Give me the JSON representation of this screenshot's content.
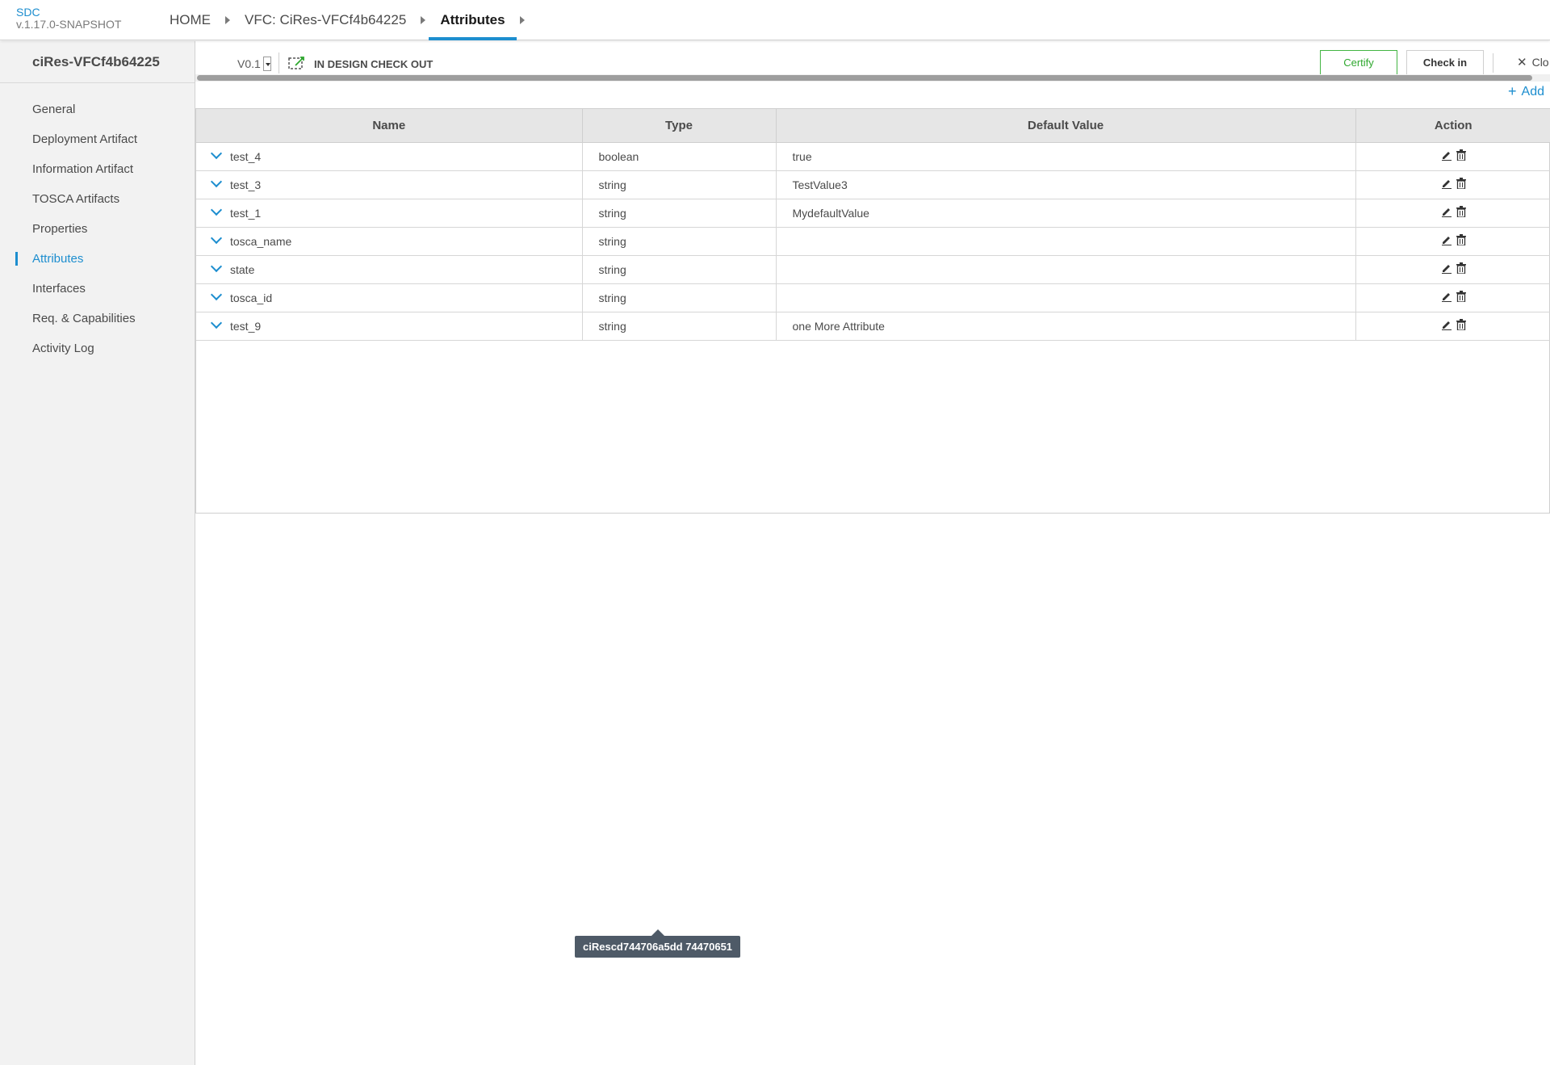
{
  "header": {
    "app_name": "SDC",
    "version": "v.1.17.0-SNAPSHOT",
    "breadcrumbs": [
      {
        "label": "HOME"
      },
      {
        "label": "VFC: CiRes-VFCf4b64225"
      },
      {
        "label": "Attributes",
        "active": true
      }
    ]
  },
  "sidebar": {
    "title": "ciRes-VFCf4b64225",
    "items": [
      {
        "label": "General"
      },
      {
        "label": "Deployment Artifact"
      },
      {
        "label": "Information Artifact"
      },
      {
        "label": "TOSCA Artifacts"
      },
      {
        "label": "Properties"
      },
      {
        "label": "Attributes",
        "active": true
      },
      {
        "label": "Interfaces"
      },
      {
        "label": "Req. & Capabilities"
      },
      {
        "label": "Activity Log"
      }
    ]
  },
  "workspace": {
    "version_selected": "V0.1",
    "status": "IN DESIGN CHECK OUT",
    "certify_label": "Certify",
    "checkin_label": "Check in",
    "close_label": "Clo",
    "add_label": "Add"
  },
  "table": {
    "columns": [
      "Name",
      "Type",
      "Default Value",
      "Action"
    ],
    "rows": [
      {
        "name": "test_4",
        "type": "boolean",
        "default": "true"
      },
      {
        "name": "test_3",
        "type": "string",
        "default": "TestValue3"
      },
      {
        "name": "test_1",
        "type": "string",
        "default": "MydefaultValue"
      },
      {
        "name": "tosca_name",
        "type": "string",
        "default": ""
      },
      {
        "name": "state",
        "type": "string",
        "default": ""
      },
      {
        "name": "tosca_id",
        "type": "string",
        "default": ""
      },
      {
        "name": "test_9",
        "type": "string",
        "default": "one More Attribute"
      }
    ]
  },
  "tooltip": {
    "text": "ciRescd744706a5dd 74470651"
  },
  "colors": {
    "accent": "#1d8ecf",
    "certify": "#2fa82f",
    "tooltip_bg": "#4e5a67",
    "sidebar_bg": "#f2f2f2",
    "table_header_bg": "#e6e6e6"
  },
  "icons": {
    "row_expand": "chevron-down-icon",
    "edit": "pencil-icon",
    "delete": "trash-icon",
    "status": "checkout-icon",
    "close": "close-icon",
    "add": "plus-icon"
  }
}
